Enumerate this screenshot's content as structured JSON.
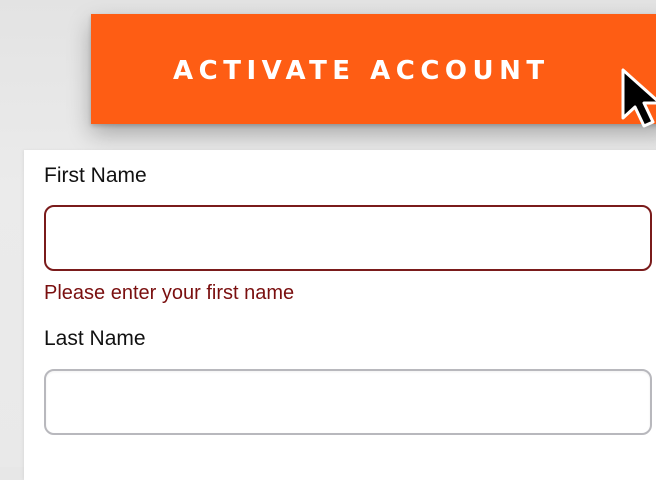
{
  "activate_button": {
    "label": "ACTIVATE ACCOUNT"
  },
  "form": {
    "first_name": {
      "label": "First Name",
      "value": "",
      "error": "Please enter your first name"
    },
    "last_name": {
      "label": "Last Name",
      "value": ""
    }
  },
  "colors": {
    "accent": "#fe5d14",
    "error": "#7a0f0f",
    "input_border": "#b8b8bd"
  },
  "icons": {
    "cursor": "mouse-pointer-arrow"
  }
}
